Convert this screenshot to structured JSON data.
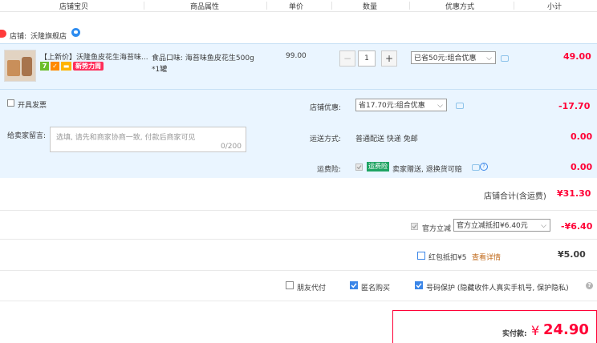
{
  "header": {
    "cols": [
      "店铺宝贝",
      "商品属性",
      "单价",
      "数量",
      "优惠方式",
      "小计"
    ]
  },
  "shop": {
    "label": "店铺:",
    "name": "沃隆旗舰店"
  },
  "item": {
    "title": "【上新价】沃隆鱼皮花生海苔味...",
    "tag_new": "新势力周",
    "attr_line1": "食品口味: 海苔味鱼皮花生500g",
    "attr_line2": "*1罐",
    "price": "99.00",
    "qty": "1",
    "discount": "已省50元:组合优惠",
    "subtotal": "49.00"
  },
  "invoice_label": "开具发票",
  "store_discount": {
    "label": "店铺优惠:",
    "value": "省17.70元:组合优惠",
    "amount": "-17.70"
  },
  "note": {
    "label": "给卖家留言:",
    "placeholder": "选填, 请先和商家协商一致, 付款后商家可见",
    "count": "0/200"
  },
  "shipping": {
    "label": "运送方式:",
    "value": "普通配送 快递 免邮",
    "amount": "0.00"
  },
  "insurance": {
    "label": "运费险:",
    "badge": "运费险",
    "value": "卖家赠送, 退换货可赔",
    "amount": "0.00"
  },
  "shop_total": {
    "label": "店铺合计(含运费)",
    "amount": "¥31.30"
  },
  "official": {
    "label": "官方立减",
    "value": "官方立减抵扣¥6.40元",
    "amount": "-¥6.40"
  },
  "redpack": {
    "label": "红包抵扣¥5",
    "link": "查看详情",
    "amount": "¥5.00"
  },
  "options": {
    "friend": "朋友代付",
    "anon": "匿名购买",
    "privacy": "号码保护 (隐藏收件人真实手机号, 保护隐私)"
  },
  "pay": {
    "label": "实付款:",
    "currency": "¥",
    "amount": "24.90"
  },
  "colors": {
    "accent_red": "#ff0036",
    "light_blue": "#eaf5ff",
    "checkbox_blue": "#3b86e8",
    "link_orange": "#c06a1b"
  }
}
